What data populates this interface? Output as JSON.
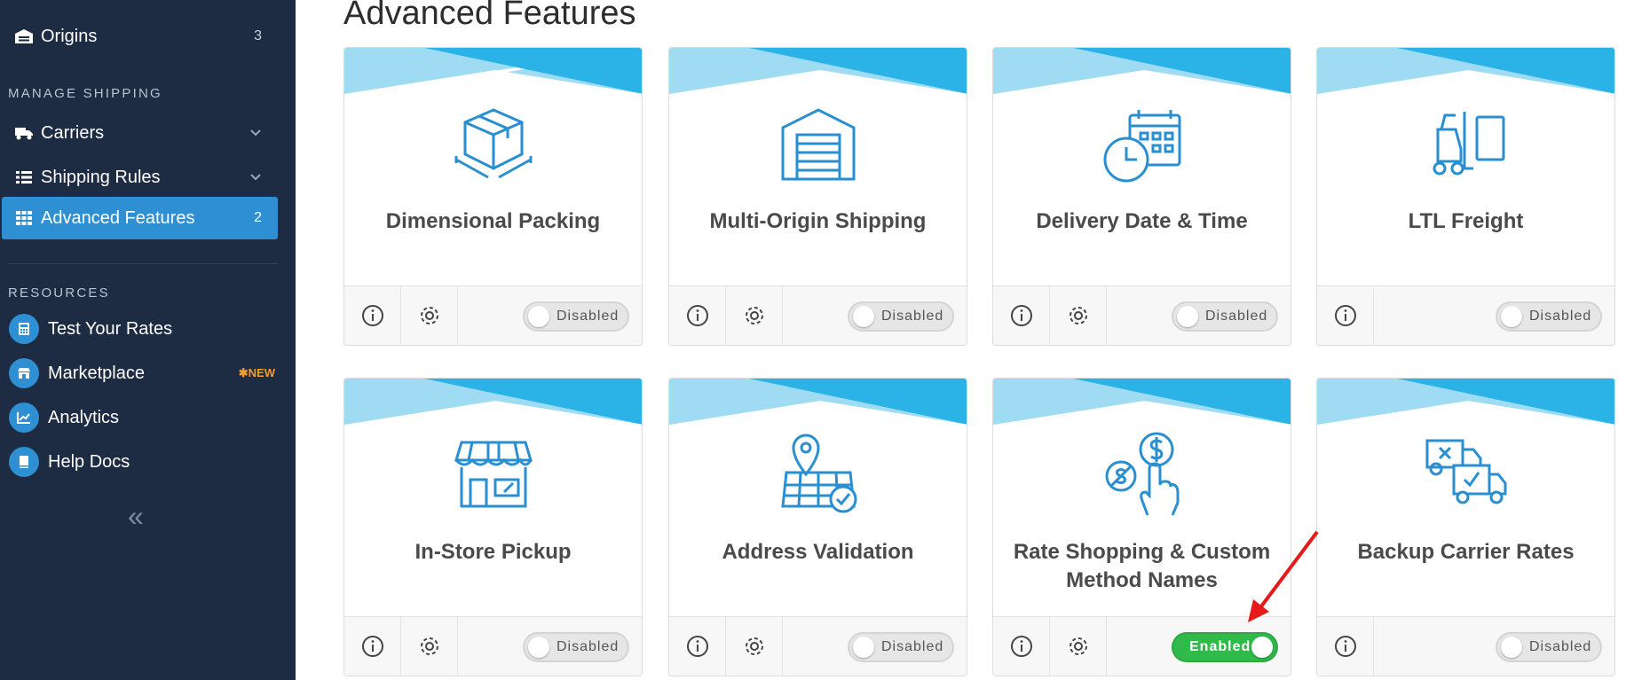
{
  "sidebar": {
    "origins": {
      "label": "Origins",
      "count": "3"
    },
    "manage_heading": "MANAGE SHIPPING",
    "carriers_label": "Carriers",
    "shipping_rules_label": "Shipping Rules",
    "advanced": {
      "label": "Advanced Features",
      "count": "2"
    },
    "resources_heading": "RESOURCES",
    "resources": [
      {
        "label": "Test Your Rates",
        "icon": "calculator-icon"
      },
      {
        "label": "Marketplace",
        "icon": "store-icon",
        "badge": "✱NEW"
      },
      {
        "label": "Analytics",
        "icon": "chart-icon"
      },
      {
        "label": "Help Docs",
        "icon": "book-icon"
      }
    ],
    "collapse_glyph": "«"
  },
  "page_title": "Advanced Features",
  "cards": [
    {
      "title": "Dimensional Packing",
      "icon": "box-dimensions-icon",
      "toggle": "Disabled",
      "enabled": false,
      "has_settings": true
    },
    {
      "title": "Multi-Origin Shipping",
      "icon": "warehouse-icon",
      "toggle": "Disabled",
      "enabled": false,
      "has_settings": true
    },
    {
      "title": "Delivery Date & Time",
      "icon": "calendar-clock-icon",
      "toggle": "Disabled",
      "enabled": false,
      "has_settings": true
    },
    {
      "title": "LTL Freight",
      "icon": "forklift-icon",
      "toggle": "Disabled",
      "enabled": false,
      "has_settings": false
    },
    {
      "title": "In-Store Pickup",
      "icon": "storefront-icon",
      "toggle": "Disabled",
      "enabled": false,
      "has_settings": true
    },
    {
      "title": "Address Validation",
      "icon": "map-pin-check-icon",
      "toggle": "Disabled",
      "enabled": false,
      "has_settings": true
    },
    {
      "title": "Rate Shopping & Custom Method Names",
      "icon": "rate-shopping-hand-icon",
      "toggle": "Enabled",
      "enabled": true,
      "has_settings": true
    },
    {
      "title": "Backup Carrier Rates",
      "icon": "backup-trucks-icon",
      "toggle": "Disabled",
      "enabled": false,
      "has_settings": false
    }
  ],
  "colors": {
    "sidebar_bg": "#1d2b43",
    "accent": "#2f8fd3",
    "banner_dark": "#2bb3e8",
    "banner_light": "#9fdcf3",
    "enabled_green": "#2fba4a",
    "arrow_red": "#e8191b",
    "new_orange": "#f39c33"
  }
}
